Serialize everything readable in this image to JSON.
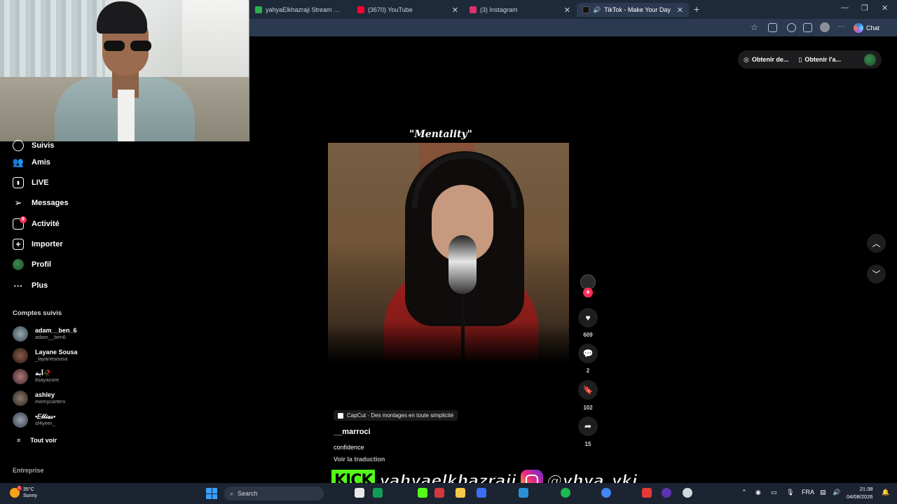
{
  "browser": {
    "tabs": [
      {
        "label": "yahyaElkhazraji Stream - Watch Li",
        "color": "#2bb24c",
        "active": false
      },
      {
        "label": "(3670) YouTube",
        "color": "#ff0033",
        "active": false
      },
      {
        "label": "(3) Instagram",
        "color": "#e1306c",
        "active": false
      },
      {
        "label": "TikTok - Make Your Day",
        "color": "#111111",
        "active": true
      }
    ],
    "copilot_label": "Chat"
  },
  "topbar": {
    "get_coins_label": "Obtenir de...",
    "get_app_label": "Obtenir l'a..."
  },
  "sidebar": {
    "items": [
      {
        "label": "Suivis",
        "icon": "following-icon"
      },
      {
        "label": "Amis",
        "icon": "friends-icon"
      },
      {
        "label": "LIVE",
        "icon": "live-icon"
      },
      {
        "label": "Messages",
        "icon": "messages-icon"
      },
      {
        "label": "Activité",
        "icon": "activity-icon",
        "badge": "8"
      },
      {
        "label": "Importer",
        "icon": "upload-icon"
      },
      {
        "label": "Profil",
        "icon": "profile-avatar"
      },
      {
        "label": "Plus",
        "icon": "more-icon"
      }
    ],
    "followed_title": "Comptes suivis",
    "accounts": [
      {
        "name": "adam__ben_6",
        "handle": "adam__ben6"
      },
      {
        "name": "Layane Sousa",
        "handle": "_layanesousa"
      },
      {
        "name": "آية🥀",
        "handle": "itsayacore"
      },
      {
        "name": "ashley",
        "handle": "momycarterx"
      },
      {
        "name": "•𝐸𝓁𝓁𝒾𝒶𝓈•",
        "handle": "sf4yeer_"
      }
    ],
    "see_all": "Tout voir",
    "footer": "Entreprise"
  },
  "video": {
    "title": "\"Mentality\"",
    "capcut_label": "CapCut · Des montages en toute simplicité",
    "author": "__marroci",
    "description": "confidence",
    "translate": "Voir la traduction",
    "likes": "609",
    "comments": "2",
    "saves": "102",
    "shares": "15",
    "accent_color": "#fe2c55"
  },
  "stream_overlay": {
    "kick_label": "KICK",
    "kick_name": "yahyaelkhazraji",
    "instagram_handle": "@yhya_ykj"
  },
  "taskbar": {
    "temperature": "35°C",
    "weather": "Sunny",
    "search_placeholder": "Search",
    "language": "FRA",
    "time": "21:38",
    "date": "04/08/2026"
  }
}
